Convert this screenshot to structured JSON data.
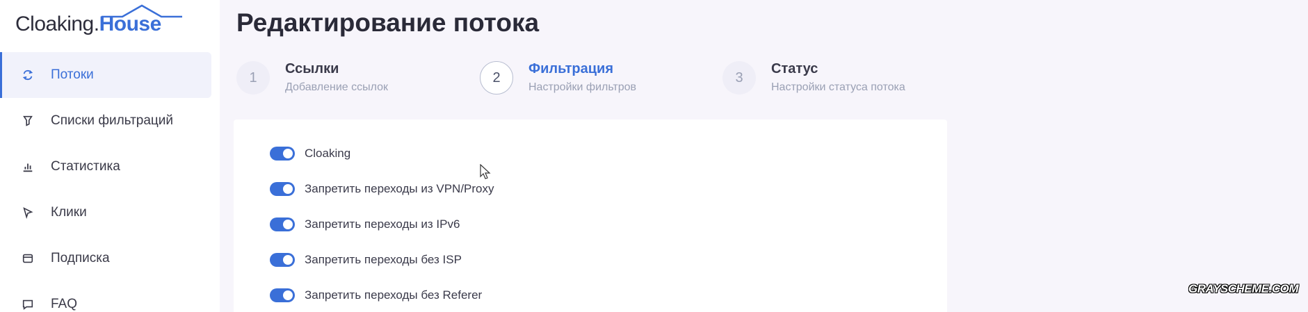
{
  "logo": {
    "part1": "Cloaking.",
    "part2": "House"
  },
  "sidebar": {
    "items": [
      {
        "label": "Потоки",
        "icon": "refresh-icon",
        "active": true
      },
      {
        "label": "Списки фильтраций",
        "icon": "filter-icon",
        "active": false
      },
      {
        "label": "Статистика",
        "icon": "bar-chart-icon",
        "active": false
      },
      {
        "label": "Клики",
        "icon": "cursor-click-icon",
        "active": false
      },
      {
        "label": "Подписка",
        "icon": "card-icon",
        "active": false
      },
      {
        "label": "FAQ",
        "icon": "chat-icon",
        "active": false
      }
    ]
  },
  "page": {
    "title": "Редактирование потока"
  },
  "steps": [
    {
      "num": "1",
      "title": "Ссылки",
      "subtitle": "Добавление ссылок",
      "active": false
    },
    {
      "num": "2",
      "title": "Фильтрация",
      "subtitle": "Настройки фильтров",
      "active": true
    },
    {
      "num": "3",
      "title": "Статус",
      "subtitle": "Настройки статуса потока",
      "active": false
    }
  ],
  "filters": [
    {
      "label": "Cloaking",
      "enabled": true
    },
    {
      "label": "Запретить переходы из VPN/Proxy",
      "enabled": true
    },
    {
      "label": "Запретить переходы из IPv6",
      "enabled": true
    },
    {
      "label": "Запретить переходы без ISP",
      "enabled": true
    },
    {
      "label": "Запретить переходы без Referer",
      "enabled": true
    }
  ],
  "watermark": "GRAYSCHEME.COM",
  "colors": {
    "accent": "#3a6fd8",
    "background": "#f7f5fb"
  }
}
